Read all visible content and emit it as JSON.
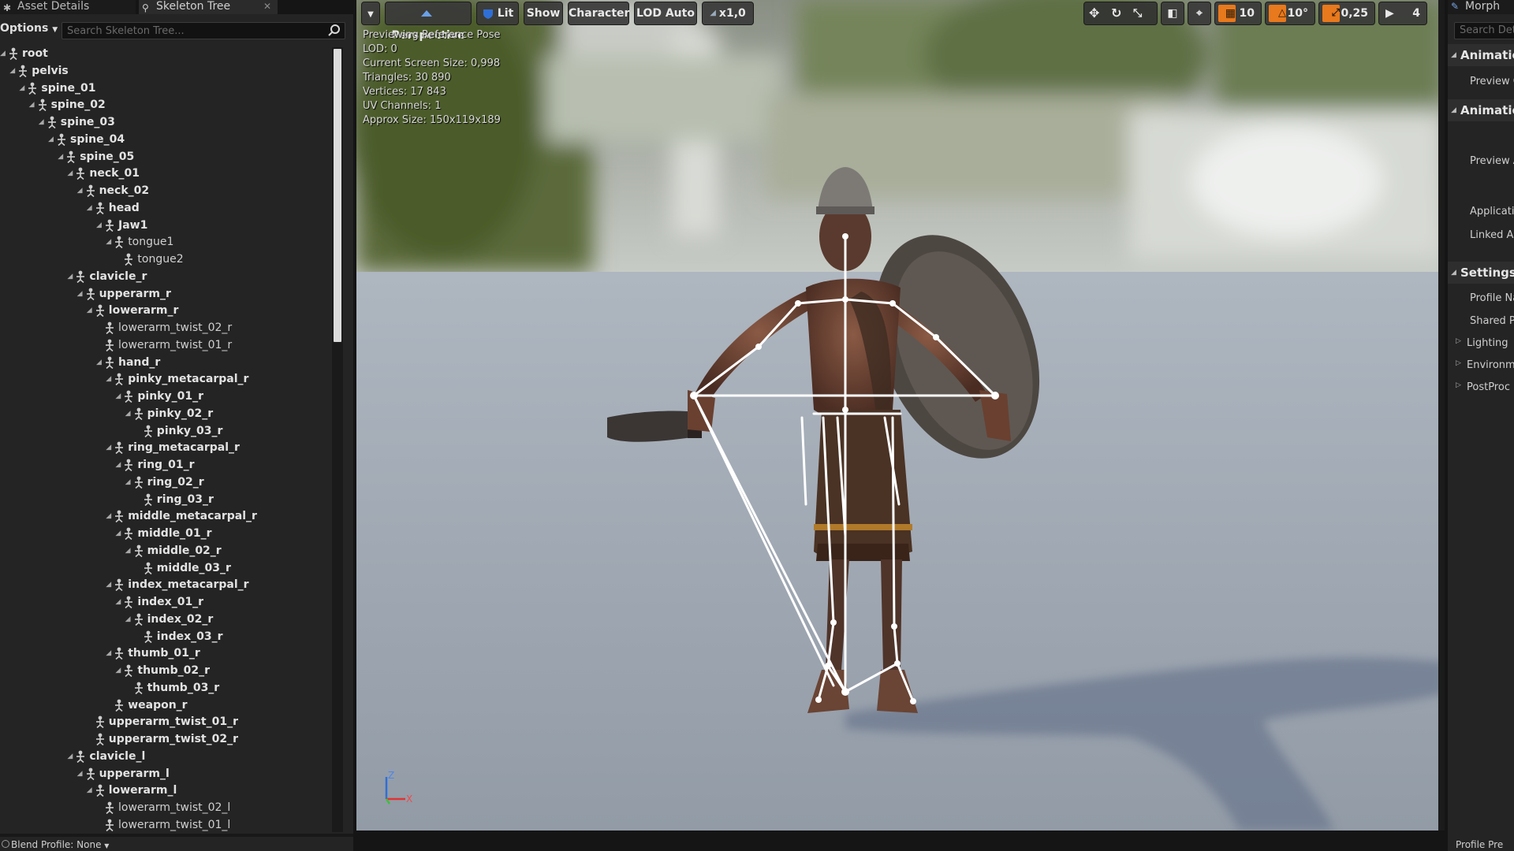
{
  "left_panel": {
    "tabs": [
      {
        "label": "Asset Details",
        "icon": "asset-details-icon"
      },
      {
        "label": "Skeleton Tree",
        "icon": "skeleton-tree-icon",
        "close_icon": "close-icon"
      }
    ],
    "options_label": "Options",
    "search_placeholder": "Search Skeleton Tree...",
    "blend_profile": "Blend Profile: None",
    "tree": [
      {
        "label": "root",
        "depth": 0,
        "expander": true,
        "bold": true
      },
      {
        "label": "pelvis",
        "depth": 1,
        "expander": true,
        "bold": true
      },
      {
        "label": "spine_01",
        "depth": 2,
        "expander": true,
        "bold": true
      },
      {
        "label": "spine_02",
        "depth": 3,
        "expander": true,
        "bold": true
      },
      {
        "label": "spine_03",
        "depth": 4,
        "expander": true,
        "bold": true
      },
      {
        "label": "spine_04",
        "depth": 5,
        "expander": true,
        "bold": true
      },
      {
        "label": "spine_05",
        "depth": 6,
        "expander": true,
        "bold": true
      },
      {
        "label": "neck_01",
        "depth": 7,
        "expander": true,
        "bold": true
      },
      {
        "label": "neck_02",
        "depth": 8,
        "expander": true,
        "bold": true
      },
      {
        "label": "head",
        "depth": 9,
        "expander": true,
        "bold": true
      },
      {
        "label": "Jaw1",
        "depth": 10,
        "expander": true,
        "bold": true
      },
      {
        "label": "tongue1",
        "depth": 11,
        "expander": true,
        "bold": false
      },
      {
        "label": "tongue2",
        "depth": 12,
        "expander": false,
        "bold": false
      },
      {
        "label": "clavicle_r",
        "depth": 7,
        "expander": true,
        "bold": true
      },
      {
        "label": "upperarm_r",
        "depth": 8,
        "expander": true,
        "bold": true
      },
      {
        "label": "lowerarm_r",
        "depth": 9,
        "expander": true,
        "bold": true
      },
      {
        "label": "lowerarm_twist_02_r",
        "depth": 10,
        "expander": false,
        "bold": false
      },
      {
        "label": "lowerarm_twist_01_r",
        "depth": 10,
        "expander": false,
        "bold": false
      },
      {
        "label": "hand_r",
        "depth": 10,
        "expander": true,
        "bold": true
      },
      {
        "label": "pinky_metacarpal_r",
        "depth": 11,
        "expander": true,
        "bold": true
      },
      {
        "label": "pinky_01_r",
        "depth": 12,
        "expander": true,
        "bold": true
      },
      {
        "label": "pinky_02_r",
        "depth": 13,
        "expander": true,
        "bold": true
      },
      {
        "label": "pinky_03_r",
        "depth": 14,
        "expander": false,
        "bold": true
      },
      {
        "label": "ring_metacarpal_r",
        "depth": 11,
        "expander": true,
        "bold": true
      },
      {
        "label": "ring_01_r",
        "depth": 12,
        "expander": true,
        "bold": true
      },
      {
        "label": "ring_02_r",
        "depth": 13,
        "expander": true,
        "bold": true
      },
      {
        "label": "ring_03_r",
        "depth": 14,
        "expander": false,
        "bold": true
      },
      {
        "label": "middle_metacarpal_r",
        "depth": 11,
        "expander": true,
        "bold": true
      },
      {
        "label": "middle_01_r",
        "depth": 12,
        "expander": true,
        "bold": true
      },
      {
        "label": "middle_02_r",
        "depth": 13,
        "expander": true,
        "bold": true
      },
      {
        "label": "middle_03_r",
        "depth": 14,
        "expander": false,
        "bold": true
      },
      {
        "label": "index_metacarpal_r",
        "depth": 11,
        "expander": true,
        "bold": true
      },
      {
        "label": "index_01_r",
        "depth": 12,
        "expander": true,
        "bold": true
      },
      {
        "label": "index_02_r",
        "depth": 13,
        "expander": true,
        "bold": true
      },
      {
        "label": "index_03_r",
        "depth": 14,
        "expander": false,
        "bold": true
      },
      {
        "label": "thumb_01_r",
        "depth": 11,
        "expander": true,
        "bold": true
      },
      {
        "label": "thumb_02_r",
        "depth": 12,
        "expander": true,
        "bold": true
      },
      {
        "label": "thumb_03_r",
        "depth": 13,
        "expander": false,
        "bold": true
      },
      {
        "label": "weapon_r",
        "depth": 11,
        "expander": false,
        "bold": true
      },
      {
        "label": "upperarm_twist_01_r",
        "depth": 9,
        "expander": false,
        "bold": true
      },
      {
        "label": "upperarm_twist_02_r",
        "depth": 9,
        "expander": false,
        "bold": true
      },
      {
        "label": "clavicle_l",
        "depth": 7,
        "expander": true,
        "bold": true
      },
      {
        "label": "upperarm_l",
        "depth": 8,
        "expander": true,
        "bold": true
      },
      {
        "label": "lowerarm_l",
        "depth": 9,
        "expander": true,
        "bold": true
      },
      {
        "label": "lowerarm_twist_02_l",
        "depth": 10,
        "expander": false,
        "bold": false
      },
      {
        "label": "lowerarm_twist_01_l",
        "depth": 10,
        "expander": false,
        "bold": false
      }
    ]
  },
  "viewport": {
    "toolbar": {
      "dropdown_icon": "chevron-down-icon",
      "perspective": "Perspective",
      "lit": "Lit",
      "show": "Show",
      "character": "Character",
      "lod": "LOD Auto",
      "speed": "x1,0",
      "grid_snap": "10",
      "rotation_snap": "10°",
      "scale_snap": "0,25",
      "camera_speed": "4"
    },
    "stats": [
      "Previewing Reference Pose",
      "LOD: 0",
      "Current Screen Size: 0,998",
      "Triangles: 30 890",
      "Vertices: 17 843",
      "UV Channels: 1",
      "Approx Size: 150x119x189"
    ],
    "axis_labels": {
      "z": "Z",
      "x": "X"
    },
    "colors": {
      "accent_orange": "#e8791c",
      "accent_blue": "#2f6fd6",
      "bone_white": "#ffffff"
    }
  },
  "right_panel": {
    "tab": "Morph",
    "search_placeholder": "Search Det",
    "sections": [
      {
        "label": "Animatic"
      },
      {
        "label": "Animatic"
      },
      {
        "label": "Settings"
      }
    ],
    "rows_anim1": [
      "Preview C"
    ],
    "rows_anim2": [
      "Preview A",
      "Applicatic",
      "Linked Ar"
    ],
    "rows_settings": [
      "Profile Na",
      "Shared Pr"
    ],
    "collapsed_rows": [
      "Lighting",
      "Environm",
      "PostProc"
    ],
    "bottom": "Profile Pre"
  }
}
